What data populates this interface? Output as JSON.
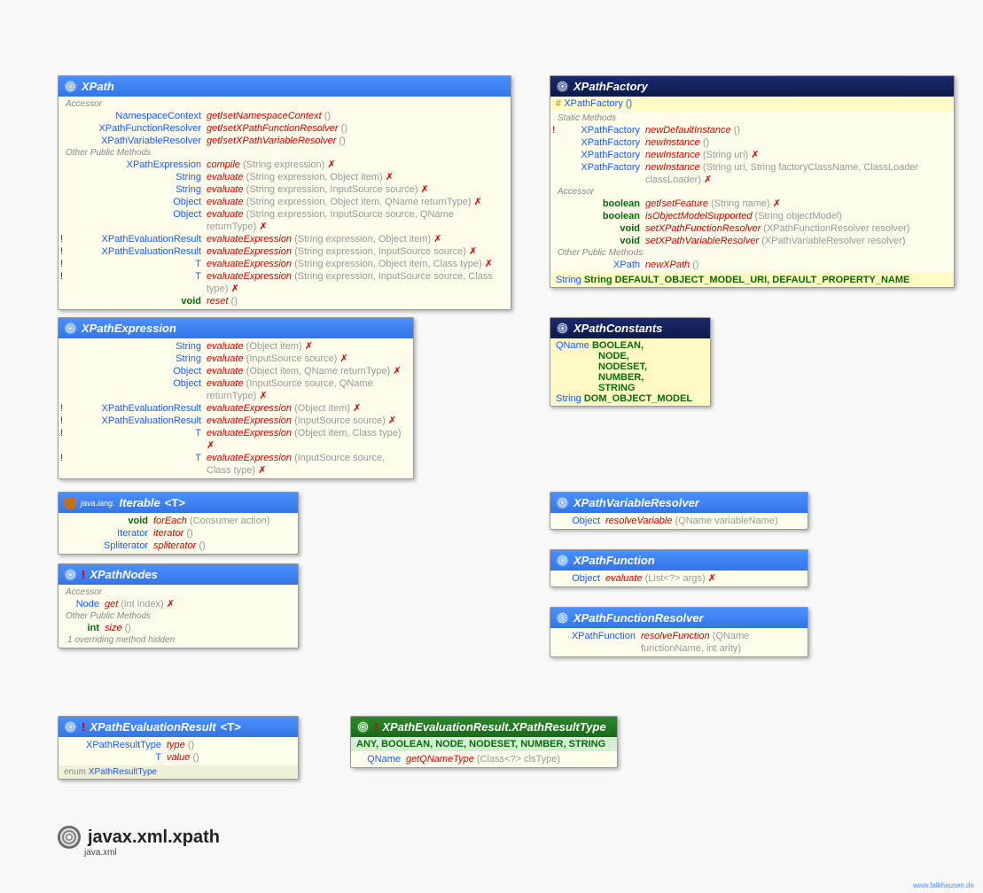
{
  "package": {
    "name": "javax.xml.xpath",
    "module": "java.xml",
    "credit": "www.falkhausen.de"
  },
  "xpath": {
    "title": "XPath",
    "sect_accessor": "Accessor",
    "sect_other": "Other Public Methods",
    "rows": [
      {
        "ret": "NamespaceContext",
        "sig": "get/setNamespaceContext ()",
        "gs": true
      },
      {
        "ret": "XPathFunctionResolver",
        "sig": "get/setXPathFunctionResolver ()",
        "gs": true
      },
      {
        "ret": "XPathVariableResolver",
        "sig": "get/setXPathVariableResolver ()",
        "gs": true
      }
    ],
    "other": [
      {
        "ret": "XPathExpression",
        "name": "compile",
        "args": "(String expression)",
        "ex": true
      },
      {
        "ret": "String",
        "name": "evaluate",
        "args": "(String expression, Object item)",
        "ex": true
      },
      {
        "ret": "String",
        "name": "evaluate",
        "args": "(String expression, InputSource source)",
        "ex": true
      },
      {
        "ret": "Object",
        "name": "evaluate",
        "args": "(String expression, Object item, QName returnType)",
        "ex": true
      },
      {
        "ret": "Object",
        "name": "evaluate",
        "args": "(String expression, InputSource source, QName returnType)",
        "ex": true
      },
      {
        "bang": true,
        "ret": "XPathEvaluationResult<?>",
        "name": "evaluateExpression",
        "args": "(String expression, Object item)",
        "ex": true
      },
      {
        "bang": true,
        "ret": "XPathEvaluationResult<?>",
        "name": "evaluateExpression",
        "args": "(String expression, InputSource source)",
        "ex": true
      },
      {
        "bang": true,
        "ret": "<T> T",
        "name": "evaluateExpression",
        "args": "(String expression, Object item, Class<T> type)",
        "ex": true
      },
      {
        "bang": true,
        "ret": "<T> T",
        "name": "evaluateExpression",
        "args": "(String expression, InputSource source, Class<T> type)",
        "ex": true
      },
      {
        "ret": "void",
        "name": "reset",
        "args": "()",
        "kw": true
      }
    ]
  },
  "xpathFactory": {
    "title": "XPathFactory",
    "constructor": "XPathFactory ()",
    "sect_static": "Static Methods",
    "sect_accessor": "Accessor",
    "sect_other": "Other Public Methods",
    "static": [
      {
        "bang": true,
        "ret": "XPathFactory",
        "name": "newDefaultInstance",
        "args": "()"
      },
      {
        "ret": "XPathFactory",
        "name": "newInstance",
        "args": "()"
      },
      {
        "ret": "XPathFactory",
        "name": "newInstance",
        "args": "(String uri)",
        "ex": true
      },
      {
        "ret": "XPathFactory",
        "name": "newInstance",
        "args": "(String uri, String factoryClassName, ClassLoader classLoader)",
        "ex": true
      }
    ],
    "accessor": [
      {
        "ret": "boolean",
        "sig": "get/setFeature (String name)",
        "gs": true,
        "ex": true,
        "kw": true
      },
      {
        "ret": "boolean",
        "name": "isObjectModelSupported",
        "args": "(String objectModel)",
        "kw": true
      },
      {
        "ret": "void",
        "name": "setXPathFunctionResolver",
        "args": "(XPathFunctionResolver resolver)",
        "kw": true
      },
      {
        "ret": "void",
        "name": "setXPathVariableResolver",
        "args": "(XPathVariableResolver resolver)",
        "kw": true
      }
    ],
    "other": [
      {
        "ret": "XPath",
        "name": "newXPath",
        "args": "()"
      }
    ],
    "constants": "String DEFAULT_OBJECT_MODEL_URI, DEFAULT_PROPERTY_NAME"
  },
  "xpathExpression": {
    "title": "XPathExpression",
    "rows": [
      {
        "ret": "String",
        "name": "evaluate",
        "args": "(Object item)",
        "ex": true
      },
      {
        "ret": "String",
        "name": "evaluate",
        "args": "(InputSource source)",
        "ex": true
      },
      {
        "ret": "Object",
        "name": "evaluate",
        "args": "(Object item, QName returnType)",
        "ex": true
      },
      {
        "ret": "Object",
        "name": "evaluate",
        "args": "(InputSource source, QName returnType)",
        "ex": true
      },
      {
        "bang": true,
        "ret": "XPathEvaluationResult<?>",
        "name": "evaluateExpression",
        "args": "(Object item)",
        "ex": true
      },
      {
        "bang": true,
        "ret": "XPathEvaluationResult<?>",
        "name": "evaluateExpression",
        "args": "(InputSource source)",
        "ex": true
      },
      {
        "bang": true,
        "ret": "<T> T",
        "name": "evaluateExpression",
        "args": "(Object item, Class<T> type)",
        "ex": true
      },
      {
        "bang": true,
        "ret": "<T> T",
        "name": "evaluateExpression",
        "args": "(InputSource source, Class<T> type)",
        "ex": true
      }
    ]
  },
  "xpathConstants": {
    "title": "XPathConstants",
    "qname_label": "QName",
    "qname": [
      "BOOLEAN,",
      "NODE,",
      "NODESET,",
      "NUMBER,",
      "STRING"
    ],
    "string_label": "String",
    "string_const": "DOM_OBJECT_MODEL"
  },
  "iterable": {
    "pkg": "java.lang.",
    "title": "Iterable",
    "tparam": "<T>",
    "rows": [
      {
        "ret": "void",
        "name": "forEach",
        "args": "(Consumer<? super T> action)",
        "kw": true
      },
      {
        "ret": "Iterator<T>",
        "name": "iterator",
        "args": "()"
      },
      {
        "ret": "Spliterator<T>",
        "name": "spliterator",
        "args": "()"
      }
    ]
  },
  "xpathNodes": {
    "title": "XPathNodes",
    "bang": true,
    "sect_accessor": "Accessor",
    "sect_other": "Other Public Methods",
    "accessor": [
      {
        "ret": "Node",
        "name": "get",
        "args": "(int index)",
        "ex": true
      }
    ],
    "other": [
      {
        "ret": "int",
        "name": "size",
        "args": "()",
        "kw": true
      }
    ],
    "note": "1 overriding method hidden"
  },
  "varResolver": {
    "title": "XPathVariableResolver",
    "ret": "Object",
    "name": "resolveVariable",
    "args": "(QName variableName)"
  },
  "xpathFunction": {
    "title": "XPathFunction",
    "ret": "Object",
    "name": "evaluate",
    "args": "(List<?> args)",
    "ex": true
  },
  "funcResolver": {
    "title": "XPathFunctionResolver",
    "ret": "XPathFunction",
    "name": "resolveFunction",
    "args": "(QName functionName, int arity)"
  },
  "evalResult": {
    "title": "XPathEvaluationResult",
    "tparam": "<T>",
    "bang": true,
    "rows": [
      {
        "ret": "XPathResultType",
        "name": "type",
        "args": "()"
      },
      {
        "ret": "T",
        "name": "value",
        "args": "()"
      }
    ],
    "sub": "enum XPathResultType"
  },
  "resultType": {
    "title": "XPathEvaluationResult.XPathResultType",
    "bang": true,
    "enum": "ANY, BOOLEAN, NODE, NODESET, NUMBER, STRING",
    "ret": "QName",
    "name": "getQNameType",
    "args": "(Class<?> clsType)"
  }
}
